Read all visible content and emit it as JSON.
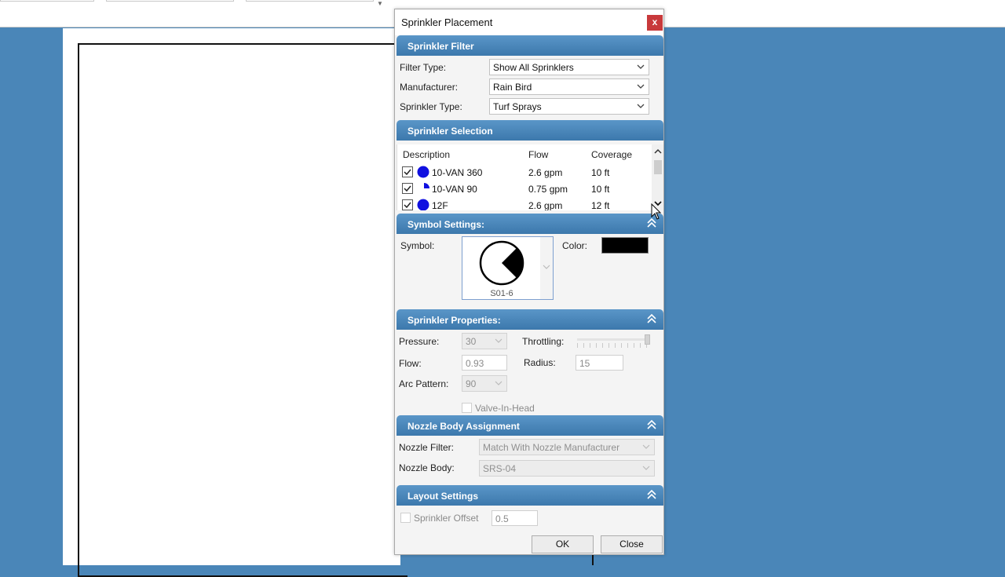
{
  "dialog": {
    "title": "Sprinkler Placement",
    "close_glyph": "x"
  },
  "sprinkler_filter": {
    "header": "Sprinkler Filter",
    "filter_type_label": "Filter Type:",
    "filter_type_value": "Show All Sprinklers",
    "manufacturer_label": "Manufacturer:",
    "manufacturer_value": "Rain Bird",
    "sprinkler_type_label": "Sprinkler Type:",
    "sprinkler_type_value": "Turf Sprays"
  },
  "sprinkler_selection": {
    "header": "Sprinkler Selection",
    "columns": [
      "Description",
      "Flow",
      "Coverage"
    ],
    "rows": [
      {
        "description": "10-VAN 360",
        "flow": "2.6 gpm",
        "coverage": "10 ft",
        "checked": true,
        "arc": "full"
      },
      {
        "description": "10-VAN 90",
        "flow": "0.75 gpm",
        "coverage": "10 ft",
        "checked": true,
        "arc": "quarter"
      },
      {
        "description": "12F",
        "flow": "2.6 gpm",
        "coverage": "12 ft",
        "checked": true,
        "arc": "full"
      }
    ],
    "symbol_color": "#1010e0"
  },
  "symbol_settings": {
    "header": "Symbol Settings:",
    "symbol_label": "Symbol:",
    "symbol_name": "S01-6",
    "color_label": "Color:",
    "color_value": "#000000"
  },
  "sprinkler_properties": {
    "header": "Sprinkler Properties:",
    "pressure_label": "Pressure:",
    "pressure_value": "30",
    "throttling_label": "Throttling:",
    "flow_label": "Flow:",
    "flow_value": "0.93",
    "radius_label": "Radius:",
    "radius_value": "15",
    "arc_pattern_label": "Arc Pattern:",
    "arc_pattern_value": "90",
    "valve_in_head_label": "Valve-In-Head"
  },
  "nozzle_body_assignment": {
    "header": "Nozzle Body Assignment",
    "nozzle_filter_label": "Nozzle Filter:",
    "nozzle_filter_value": "Match With Nozzle Manufacturer",
    "nozzle_body_label": "Nozzle Body:",
    "nozzle_body_value": "SRS-04"
  },
  "layout_settings": {
    "header": "Layout Settings",
    "sprinkler_offset_label": "Sprinkler Offset",
    "sprinkler_offset_value": "0.5"
  },
  "buttons": {
    "ok": "OK",
    "close": "Close"
  },
  "colors": {
    "background": "#4a86b8",
    "section_header": "#4a86bd",
    "close_button": "#c8393b"
  },
  "icons": {
    "collapse": "double-chevron-up-icon",
    "dropdown": "chevron-down-icon"
  }
}
